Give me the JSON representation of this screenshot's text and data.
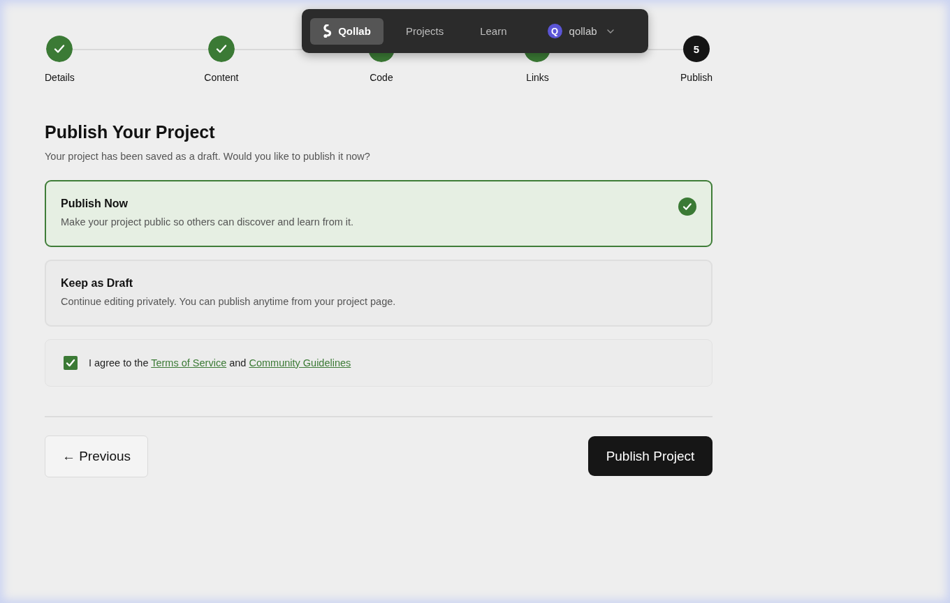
{
  "steps": [
    {
      "label": "Details",
      "completed": true
    },
    {
      "label": "Content",
      "completed": true
    },
    {
      "label": "Code",
      "completed": true
    },
    {
      "label": "Links",
      "completed": true
    },
    {
      "label": "Publish",
      "completed": false,
      "number": "5"
    }
  ],
  "nav": {
    "brand": "Qollab",
    "links": [
      {
        "label": "Projects"
      },
      {
        "label": "Learn"
      }
    ],
    "user": {
      "initial": "Q",
      "name": "qollab"
    }
  },
  "title": "Publish Your Project",
  "subtitle": "Your project has been saved as a draft. Would you like to publish it now?",
  "options": [
    {
      "title": "Publish Now",
      "description": "Make your project public so others can discover and learn from it.",
      "selected": true
    },
    {
      "title": "Keep as Draft",
      "description": "Continue editing privately. You can publish anytime from your project page.",
      "selected": false
    }
  ],
  "agreement": {
    "checked": true,
    "prefix": "I agree to the",
    "link1": "Terms of Service",
    "middle": "and",
    "link2": "Community Guidelines"
  },
  "buttons": {
    "previous": "← Previous",
    "publish": "Publish Project"
  }
}
